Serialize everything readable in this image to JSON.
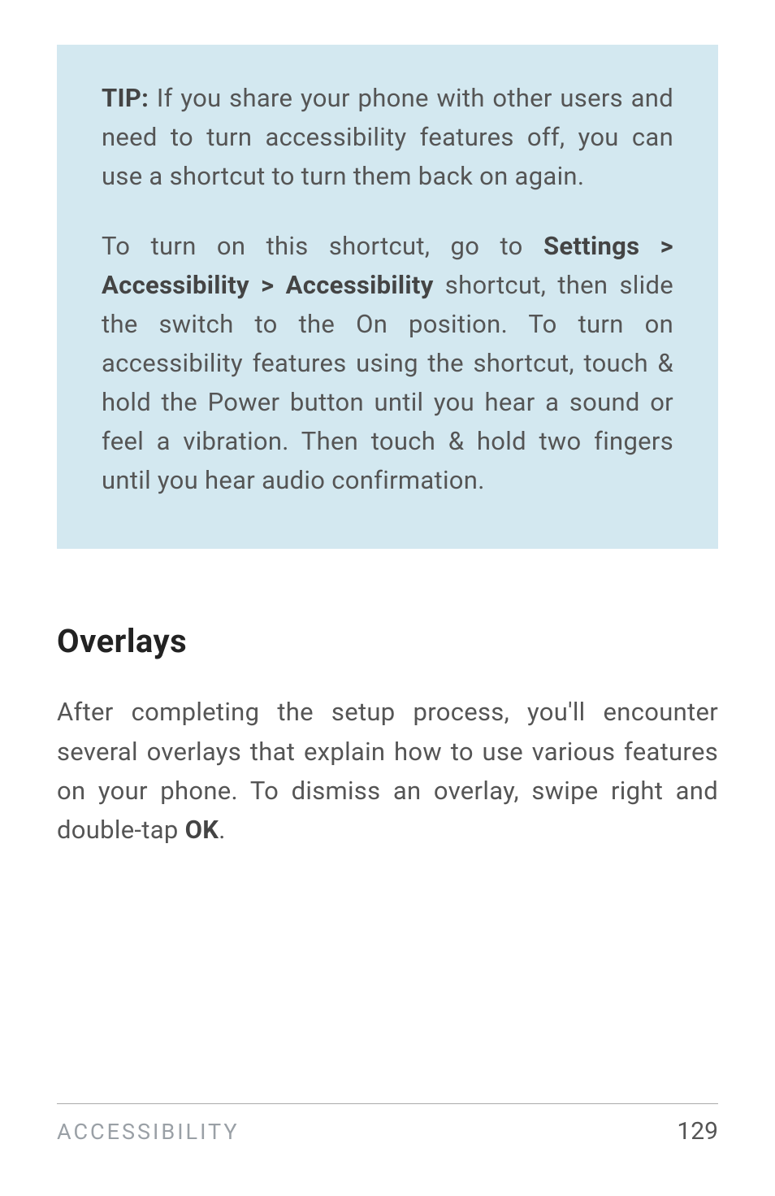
{
  "tip": {
    "label": "TIP:",
    "para1_rest": " If you share your phone with other users and need to turn accessibility features off, you can use a shortcut to turn them back on again.",
    "para2_before": "To turn on this shortcut, go to ",
    "para2_bold": "Settings > Accessibility > Accessibility",
    "para2_after": " shortcut, then slide the switch to the On position. To turn on accessibility features using the shortcut, touch & hold the Power button until you hear a sound or feel a vibration. Then touch & hold two fingers until you hear audio confirmation."
  },
  "section": {
    "heading": "Overlays",
    "body_before": "After completing the setup process, you'll encounter several overlays that explain how to use various features on your phone. To dismiss an overlay, swipe right and double-tap ",
    "body_bold": "OK",
    "body_after": "."
  },
  "footer": {
    "label": "ACCESSIBILITY",
    "page": "129"
  }
}
